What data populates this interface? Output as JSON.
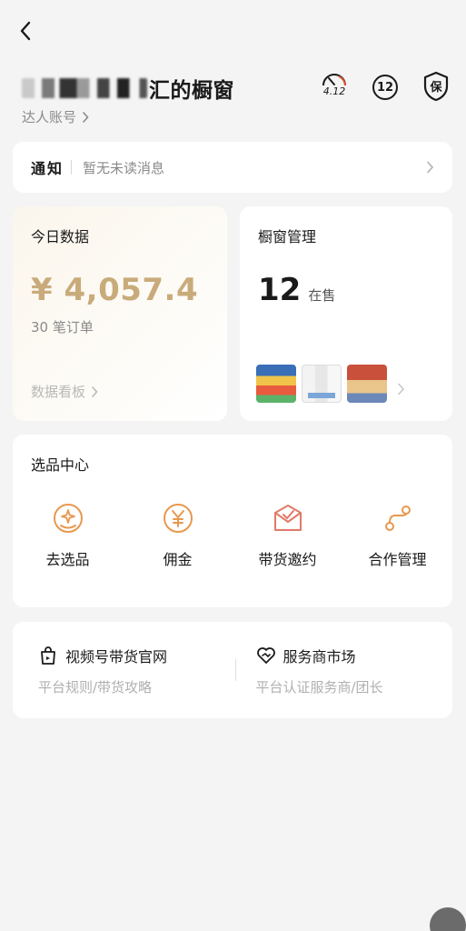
{
  "header": {
    "back_icon": "chevron-left-icon",
    "shop_title_suffix": "汇的橱窗",
    "account_link": "达人账号",
    "speed_value": "4.12",
    "badge_count": "12",
    "shield_label": "保"
  },
  "notice": {
    "title": "通知",
    "text": "暂无未读消息"
  },
  "today": {
    "title": "今日数据",
    "amount": "¥ 4,057.4",
    "orders": "30 笔订单",
    "link": "数据看板"
  },
  "window": {
    "title": "橱窗管理",
    "count": "12",
    "unit": "在售"
  },
  "select_center": {
    "title": "选品中心",
    "items": [
      {
        "label": "去选品",
        "icon": "product-pick-icon"
      },
      {
        "label": "佣金",
        "icon": "yen-coin-icon"
      },
      {
        "label": "带货邀约",
        "icon": "invite-envelope-icon"
      },
      {
        "label": "合作管理",
        "icon": "collaboration-icon"
      }
    ]
  },
  "bottom": {
    "left_title": "视频号带货官网",
    "left_sub": "平台规则/带货攻略",
    "right_title": "服务商市场",
    "right_sub": "平台认证服务商/团长"
  },
  "colors": {
    "accent_gold": "#c9ab7b",
    "icon_orange": "#e8984e",
    "background": "#f4f4f4"
  }
}
